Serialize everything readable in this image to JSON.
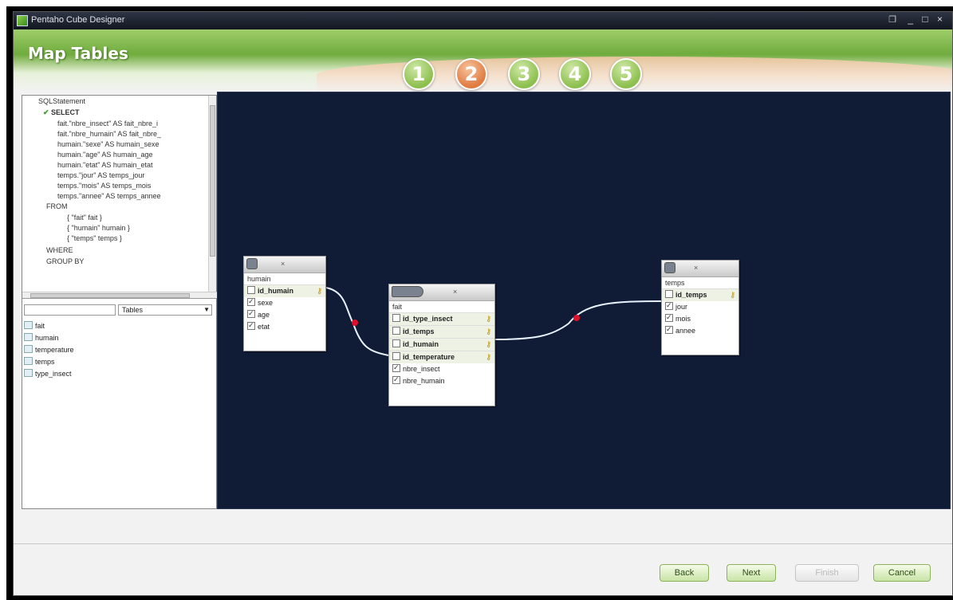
{
  "window": {
    "title": "Pentaho Cube Designer",
    "controls": "_ □ ×",
    "restore_glyph": "❐"
  },
  "header": {
    "page_title": "Map Tables",
    "steps": [
      "1",
      "2",
      "3",
      "4",
      "5"
    ],
    "active_step": "2"
  },
  "sql_tree": {
    "nodes": [
      "SELECT",
      "fait.\"nbre_insect\" AS fait_nbre_i",
      "fait.\"nbre_humain\" AS fait_nbre_",
      "humain.\"sexe\" AS humain_sexe",
      "humain.\"age\" AS humain_age",
      "humain.\"etat\" AS humain_etat",
      "temps.\"jour\" AS temps_jour",
      "temps.\"mois\" AS temps_mois",
      "temps.\"annee\" AS temps_annee",
      "FROM",
      "{ \"fait\" fait }",
      "{ \"humain\" humain }",
      "{ \"temps\" temps }",
      "WHERE",
      "GROUP BY"
    ],
    "root": "SQLStatement"
  },
  "filter": {
    "value": "",
    "select_value": "Tables"
  },
  "tables_list": [
    "fait",
    "humain",
    "temperature",
    "temps",
    "type_insect"
  ],
  "canvas": {
    "tables": [
      {
        "name": "humain",
        "columns": [
          {
            "label": "id_humain",
            "key": true,
            "checked": false
          },
          {
            "label": "sexe",
            "key": false,
            "checked": true
          },
          {
            "label": "age",
            "key": false,
            "checked": true
          },
          {
            "label": "etat",
            "key": false,
            "checked": true
          }
        ]
      },
      {
        "name": "fait",
        "columns": [
          {
            "label": "id_type_insect",
            "key": true,
            "checked": false
          },
          {
            "label": "id_temps",
            "key": true,
            "checked": false
          },
          {
            "label": "id_humain",
            "key": true,
            "checked": false
          },
          {
            "label": "id_temperature",
            "key": true,
            "checked": false
          },
          {
            "label": "nbre_insect",
            "key": false,
            "checked": true
          },
          {
            "label": "nbre_humain",
            "key": false,
            "checked": true
          }
        ]
      },
      {
        "name": "temps",
        "columns": [
          {
            "label": "id_temps",
            "key": true,
            "checked": false
          },
          {
            "label": "jour",
            "key": false,
            "checked": true
          },
          {
            "label": "mois",
            "key": false,
            "checked": true
          },
          {
            "label": "annee",
            "key": false,
            "checked": true
          }
        ]
      }
    ],
    "link_color": "#e8f2ff",
    "link_dot_color": "#e0102a",
    "background": "#101b36"
  },
  "buttons": {
    "back": "Back",
    "next": "Next",
    "finish": "Finish",
    "cancel": "Cancel"
  }
}
